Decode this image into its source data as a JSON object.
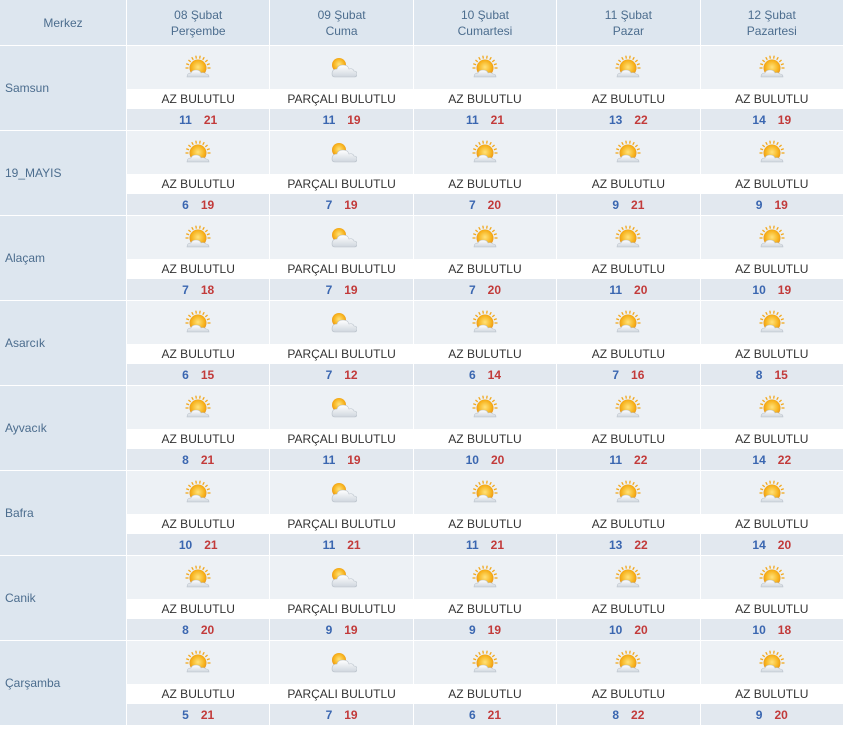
{
  "header": {
    "corner_label": "Merkez",
    "days": [
      {
        "date": "08 Şubat",
        "weekday": "Perşembe"
      },
      {
        "date": "09 Şubat",
        "weekday": "Cuma"
      },
      {
        "date": "10 Şubat",
        "weekday": "Cumartesi"
      },
      {
        "date": "11 Şubat",
        "weekday": "Pazar"
      },
      {
        "date": "12 Şubat",
        "weekday": "Pazartesi"
      }
    ]
  },
  "icons": {
    "AZ BULUTLU": "partly-sunny-icon",
    "PARÇALI BULUTLU": "mostly-cloudy-icon"
  },
  "colors": {
    "min_temp": "#3a66b0",
    "max_temp": "#c23a3a",
    "header_bg": "#dde6ef"
  },
  "rows": [
    {
      "city": "Samsun",
      "days": [
        {
          "desc": "AZ BULUTLU",
          "min": "11",
          "max": "21"
        },
        {
          "desc": "PARÇALI BULUTLU",
          "min": "11",
          "max": "19"
        },
        {
          "desc": "AZ BULUTLU",
          "min": "11",
          "max": "21"
        },
        {
          "desc": "AZ BULUTLU",
          "min": "13",
          "max": "22"
        },
        {
          "desc": "AZ BULUTLU",
          "min": "14",
          "max": "19"
        }
      ]
    },
    {
      "city": "19_MAYIS",
      "days": [
        {
          "desc": "AZ BULUTLU",
          "min": "6",
          "max": "19"
        },
        {
          "desc": "PARÇALI BULUTLU",
          "min": "7",
          "max": "19"
        },
        {
          "desc": "AZ BULUTLU",
          "min": "7",
          "max": "20"
        },
        {
          "desc": "AZ BULUTLU",
          "min": "9",
          "max": "21"
        },
        {
          "desc": "AZ BULUTLU",
          "min": "9",
          "max": "19"
        }
      ]
    },
    {
      "city": "Alaçam",
      "days": [
        {
          "desc": "AZ BULUTLU",
          "min": "7",
          "max": "18"
        },
        {
          "desc": "PARÇALI BULUTLU",
          "min": "7",
          "max": "19"
        },
        {
          "desc": "AZ BULUTLU",
          "min": "7",
          "max": "20"
        },
        {
          "desc": "AZ BULUTLU",
          "min": "11",
          "max": "20"
        },
        {
          "desc": "AZ BULUTLU",
          "min": "10",
          "max": "19"
        }
      ]
    },
    {
      "city": "Asarcık",
      "days": [
        {
          "desc": "AZ BULUTLU",
          "min": "6",
          "max": "15"
        },
        {
          "desc": "PARÇALI BULUTLU",
          "min": "7",
          "max": "12"
        },
        {
          "desc": "AZ BULUTLU",
          "min": "6",
          "max": "14"
        },
        {
          "desc": "AZ BULUTLU",
          "min": "7",
          "max": "16"
        },
        {
          "desc": "AZ BULUTLU",
          "min": "8",
          "max": "15"
        }
      ]
    },
    {
      "city": "Ayvacık",
      "days": [
        {
          "desc": "AZ BULUTLU",
          "min": "8",
          "max": "21"
        },
        {
          "desc": "PARÇALI BULUTLU",
          "min": "11",
          "max": "19"
        },
        {
          "desc": "AZ BULUTLU",
          "min": "10",
          "max": "20"
        },
        {
          "desc": "AZ BULUTLU",
          "min": "11",
          "max": "22"
        },
        {
          "desc": "AZ BULUTLU",
          "min": "14",
          "max": "22"
        }
      ]
    },
    {
      "city": "Bafra",
      "days": [
        {
          "desc": "AZ BULUTLU",
          "min": "10",
          "max": "21"
        },
        {
          "desc": "PARÇALI BULUTLU",
          "min": "11",
          "max": "21"
        },
        {
          "desc": "AZ BULUTLU",
          "min": "11",
          "max": "21"
        },
        {
          "desc": "AZ BULUTLU",
          "min": "13",
          "max": "22"
        },
        {
          "desc": "AZ BULUTLU",
          "min": "14",
          "max": "20"
        }
      ]
    },
    {
      "city": "Canik",
      "days": [
        {
          "desc": "AZ BULUTLU",
          "min": "8",
          "max": "20"
        },
        {
          "desc": "PARÇALI BULUTLU",
          "min": "9",
          "max": "19"
        },
        {
          "desc": "AZ BULUTLU",
          "min": "9",
          "max": "19"
        },
        {
          "desc": "AZ BULUTLU",
          "min": "10",
          "max": "20"
        },
        {
          "desc": "AZ BULUTLU",
          "min": "10",
          "max": "18"
        }
      ]
    },
    {
      "city": "Çarşamba",
      "days": [
        {
          "desc": "AZ BULUTLU",
          "min": "5",
          "max": "21"
        },
        {
          "desc": "PARÇALI BULUTLU",
          "min": "7",
          "max": "19"
        },
        {
          "desc": "AZ BULUTLU",
          "min": "6",
          "max": "21"
        },
        {
          "desc": "AZ BULUTLU",
          "min": "8",
          "max": "22"
        },
        {
          "desc": "AZ BULUTLU",
          "min": "9",
          "max": "20"
        }
      ]
    }
  ]
}
